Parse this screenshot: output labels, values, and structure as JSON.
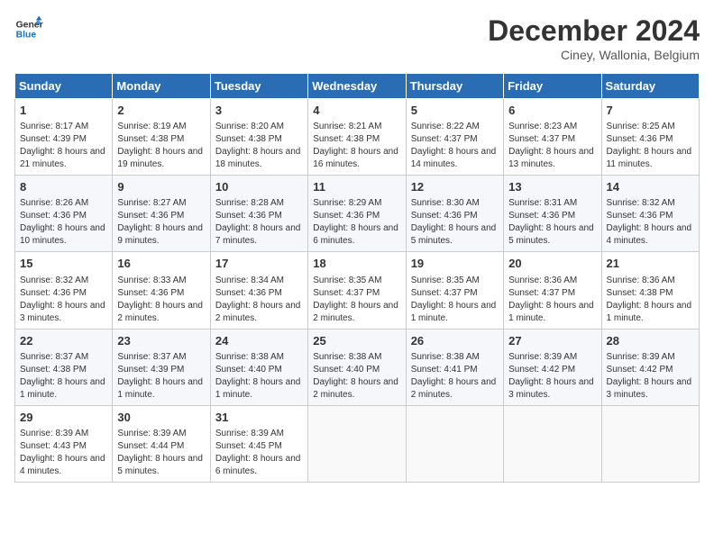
{
  "header": {
    "logo_line1": "General",
    "logo_line2": "Blue",
    "month": "December 2024",
    "location": "Ciney, Wallonia, Belgium"
  },
  "days_of_week": [
    "Sunday",
    "Monday",
    "Tuesday",
    "Wednesday",
    "Thursday",
    "Friday",
    "Saturday"
  ],
  "weeks": [
    [
      {
        "day": "1",
        "sunrise": "8:17 AM",
        "sunset": "4:39 PM",
        "daylight": "8 hours and 21 minutes."
      },
      {
        "day": "2",
        "sunrise": "8:19 AM",
        "sunset": "4:38 PM",
        "daylight": "8 hours and 19 minutes."
      },
      {
        "day": "3",
        "sunrise": "8:20 AM",
        "sunset": "4:38 PM",
        "daylight": "8 hours and 18 minutes."
      },
      {
        "day": "4",
        "sunrise": "8:21 AM",
        "sunset": "4:38 PM",
        "daylight": "8 hours and 16 minutes."
      },
      {
        "day": "5",
        "sunrise": "8:22 AM",
        "sunset": "4:37 PM",
        "daylight": "8 hours and 14 minutes."
      },
      {
        "day": "6",
        "sunrise": "8:23 AM",
        "sunset": "4:37 PM",
        "daylight": "8 hours and 13 minutes."
      },
      {
        "day": "7",
        "sunrise": "8:25 AM",
        "sunset": "4:36 PM",
        "daylight": "8 hours and 11 minutes."
      }
    ],
    [
      {
        "day": "8",
        "sunrise": "8:26 AM",
        "sunset": "4:36 PM",
        "daylight": "8 hours and 10 minutes."
      },
      {
        "day": "9",
        "sunrise": "8:27 AM",
        "sunset": "4:36 PM",
        "daylight": "8 hours and 9 minutes."
      },
      {
        "day": "10",
        "sunrise": "8:28 AM",
        "sunset": "4:36 PM",
        "daylight": "8 hours and 7 minutes."
      },
      {
        "day": "11",
        "sunrise": "8:29 AM",
        "sunset": "4:36 PM",
        "daylight": "8 hours and 6 minutes."
      },
      {
        "day": "12",
        "sunrise": "8:30 AM",
        "sunset": "4:36 PM",
        "daylight": "8 hours and 5 minutes."
      },
      {
        "day": "13",
        "sunrise": "8:31 AM",
        "sunset": "4:36 PM",
        "daylight": "8 hours and 5 minutes."
      },
      {
        "day": "14",
        "sunrise": "8:32 AM",
        "sunset": "4:36 PM",
        "daylight": "8 hours and 4 minutes."
      }
    ],
    [
      {
        "day": "15",
        "sunrise": "8:32 AM",
        "sunset": "4:36 PM",
        "daylight": "8 hours and 3 minutes."
      },
      {
        "day": "16",
        "sunrise": "8:33 AM",
        "sunset": "4:36 PM",
        "daylight": "8 hours and 2 minutes."
      },
      {
        "day": "17",
        "sunrise": "8:34 AM",
        "sunset": "4:36 PM",
        "daylight": "8 hours and 2 minutes."
      },
      {
        "day": "18",
        "sunrise": "8:35 AM",
        "sunset": "4:37 PM",
        "daylight": "8 hours and 2 minutes."
      },
      {
        "day": "19",
        "sunrise": "8:35 AM",
        "sunset": "4:37 PM",
        "daylight": "8 hours and 1 minute."
      },
      {
        "day": "20",
        "sunrise": "8:36 AM",
        "sunset": "4:37 PM",
        "daylight": "8 hours and 1 minute."
      },
      {
        "day": "21",
        "sunrise": "8:36 AM",
        "sunset": "4:38 PM",
        "daylight": "8 hours and 1 minute."
      }
    ],
    [
      {
        "day": "22",
        "sunrise": "8:37 AM",
        "sunset": "4:38 PM",
        "daylight": "8 hours and 1 minute."
      },
      {
        "day": "23",
        "sunrise": "8:37 AM",
        "sunset": "4:39 PM",
        "daylight": "8 hours and 1 minute."
      },
      {
        "day": "24",
        "sunrise": "8:38 AM",
        "sunset": "4:40 PM",
        "daylight": "8 hours and 1 minute."
      },
      {
        "day": "25",
        "sunrise": "8:38 AM",
        "sunset": "4:40 PM",
        "daylight": "8 hours and 2 minutes."
      },
      {
        "day": "26",
        "sunrise": "8:38 AM",
        "sunset": "4:41 PM",
        "daylight": "8 hours and 2 minutes."
      },
      {
        "day": "27",
        "sunrise": "8:39 AM",
        "sunset": "4:42 PM",
        "daylight": "8 hours and 3 minutes."
      },
      {
        "day": "28",
        "sunrise": "8:39 AM",
        "sunset": "4:42 PM",
        "daylight": "8 hours and 3 minutes."
      }
    ],
    [
      {
        "day": "29",
        "sunrise": "8:39 AM",
        "sunset": "4:43 PM",
        "daylight": "8 hours and 4 minutes."
      },
      {
        "day": "30",
        "sunrise": "8:39 AM",
        "sunset": "4:44 PM",
        "daylight": "8 hours and 5 minutes."
      },
      {
        "day": "31",
        "sunrise": "8:39 AM",
        "sunset": "4:45 PM",
        "daylight": "8 hours and 6 minutes."
      },
      null,
      null,
      null,
      null
    ]
  ],
  "labels": {
    "sunrise": "Sunrise:",
    "sunset": "Sunset:",
    "daylight": "Daylight:"
  }
}
